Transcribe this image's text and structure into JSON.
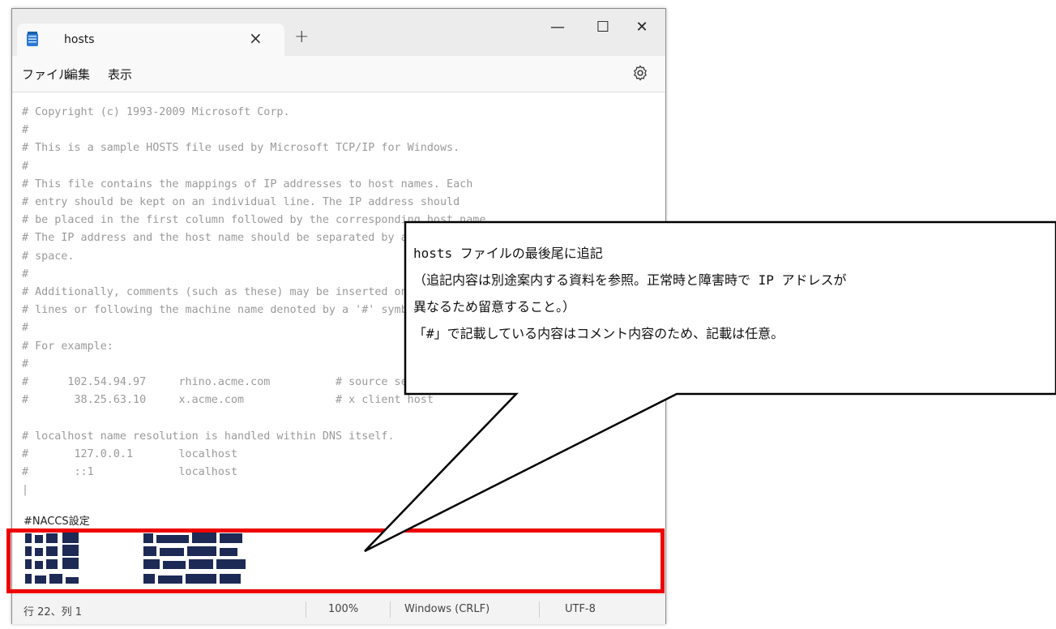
{
  "tab": {
    "title": "hosts",
    "close": "×",
    "new_tab": "+"
  },
  "window_controls": {
    "minimize": "—",
    "maximize": "☐",
    "close": "✕"
  },
  "menu": [
    "ファイル",
    "編集",
    "表示"
  ],
  "editor": {
    "lines": [
      "# Copyright (c) 1993-2009 Microsoft Corp.",
      "#",
      "# This is a sample HOSTS file used by Microsoft TCP/IP for Windows.",
      "#",
      "# This file contains the mappings of IP addresses to host names. Each",
      "# entry should be kept on an individual line. The IP address should",
      "# be placed in the first column followed by the corresponding host name.",
      "# The IP address and the host name should be separated by at least one",
      "# space.",
      "#",
      "# Additionally, comments (such as these) may be inserted on individual",
      "# lines or following the machine name denoted by a '#' symbol.",
      "#",
      "# For example:",
      "#",
      "#      102.54.94.97     rhino.acme.com          # source server",
      "#       38.25.63.10     x.acme.com              # x client host",
      "",
      "# localhost name resolution is handled within DNS itself.",
      "#       127.0.0.1       localhost",
      "#       ::1             localhost",
      "|"
    ],
    "naccs_label": "#NACCS設定"
  },
  "status": {
    "position": "行 22、列 1",
    "zoom": "100%",
    "line_ending": "Windows (CRLF)",
    "encoding": "UTF-8"
  },
  "callout": {
    "lines": [
      "hosts ファイルの最後尾に追記",
      "（追記内容は別途案内する資料を参照。正常時と障害時で IP アドレスが",
      "異なるため留意すること。）",
      "「#」で記載している内容はコメント内容のため、記載は任意。"
    ]
  },
  "colors": {
    "highlight": "#ee0000",
    "comment_text": "#9a9a9a"
  }
}
